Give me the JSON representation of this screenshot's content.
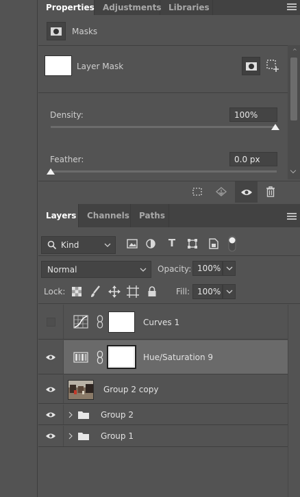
{
  "properties": {
    "tabs": [
      {
        "label": "Properties",
        "active": true
      },
      {
        "label": "Adjustments",
        "active": false
      },
      {
        "label": "Libraries",
        "active": false
      }
    ],
    "masks_label": "Masks",
    "layer_mask_label": "Layer Mask",
    "density_label": "Density:",
    "density_value": "100%",
    "density_level": 1.0,
    "feather_label": "Feather:",
    "feather_value": "0.0 px",
    "feather_level": 0.0
  },
  "layers_panel": {
    "tabs": [
      {
        "label": "Layers",
        "active": true
      },
      {
        "label": "Channels",
        "active": false
      },
      {
        "label": "Paths",
        "active": false
      }
    ],
    "filter_kind": "Kind",
    "blend_mode": "Normal",
    "opacity_label": "Opacity:",
    "opacity_value": "100%",
    "lock_label": "Lock:",
    "fill_label": "Fill:",
    "fill_value": "100%",
    "layers": [
      {
        "name": "Curves 1",
        "visible": false,
        "selected": false
      },
      {
        "name": "Hue/Saturation 9",
        "visible": true,
        "selected": true
      },
      {
        "name": "Group 2 copy",
        "visible": true,
        "selected": false
      },
      {
        "name": "Group 2",
        "visible": true,
        "selected": false
      },
      {
        "name": "Group 1",
        "visible": true,
        "selected": false
      }
    ]
  },
  "colors": {
    "panel_bg": "#535353",
    "tab_bar": "#424242",
    "selected_row": "#6a6a6a"
  }
}
